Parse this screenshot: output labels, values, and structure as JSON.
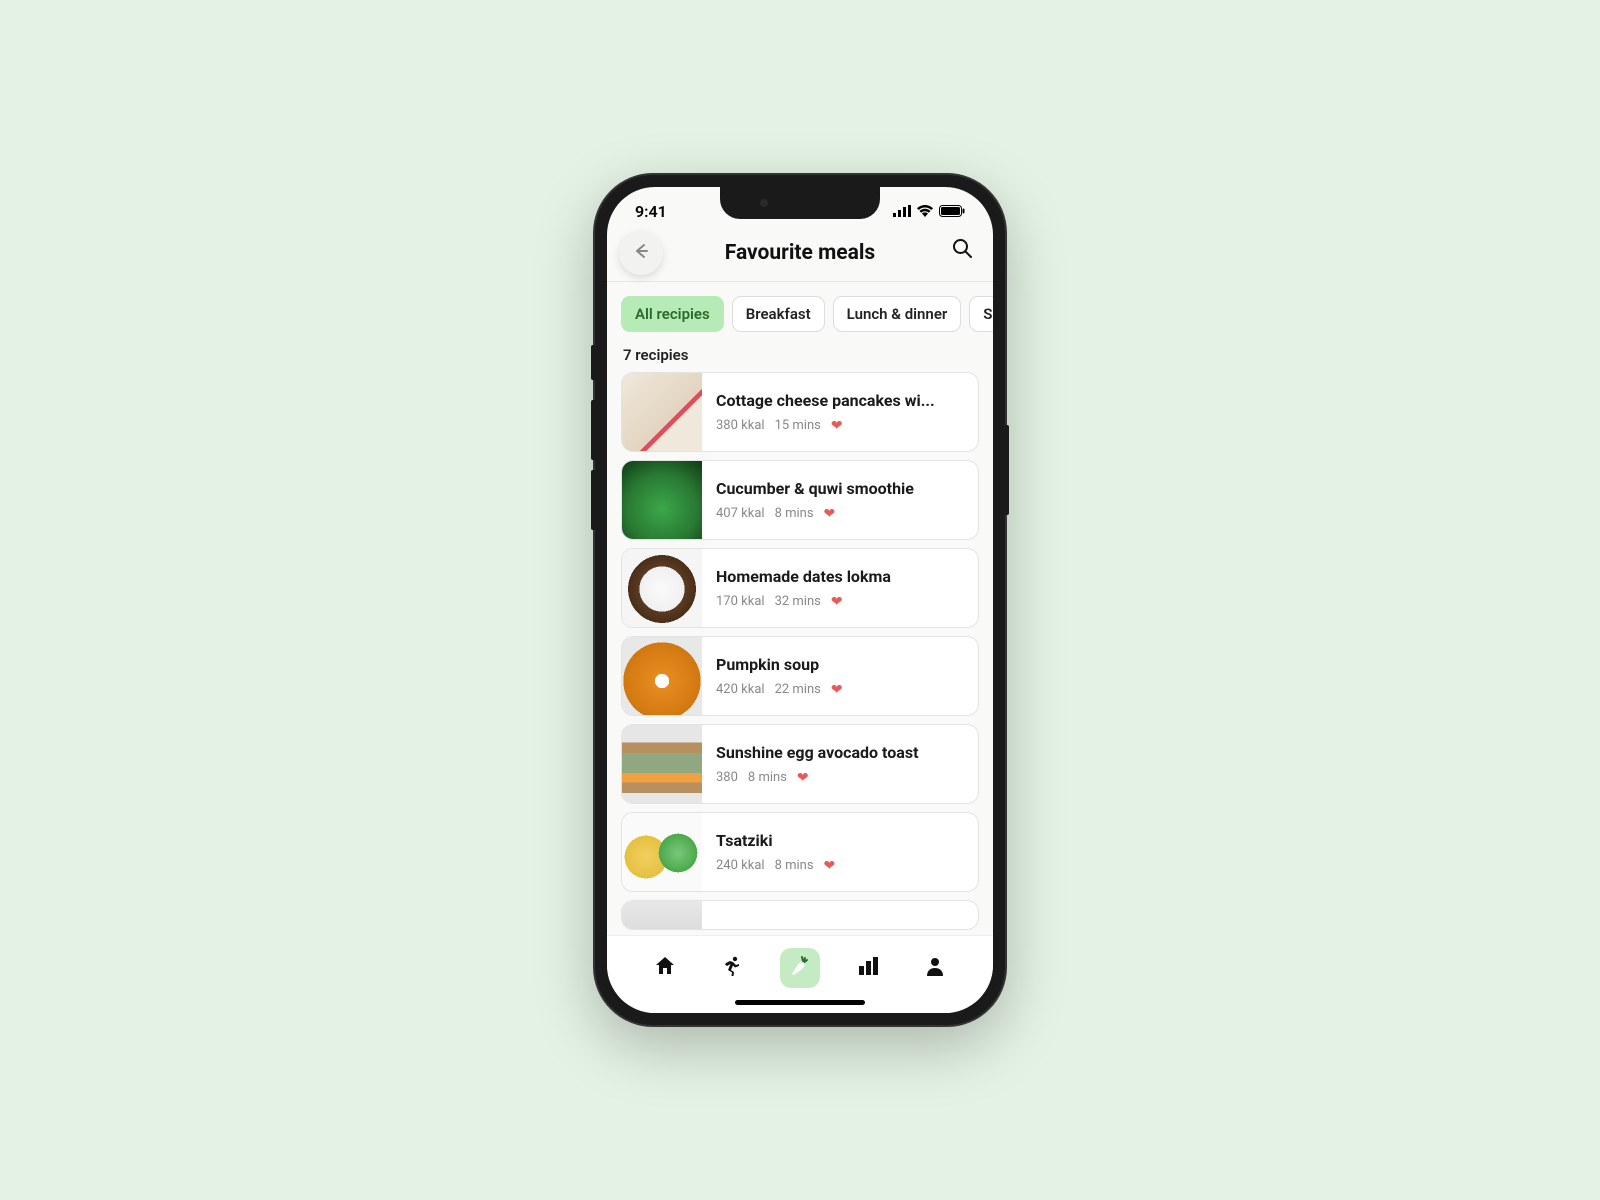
{
  "status": {
    "time": "9:41"
  },
  "header": {
    "title": "Favourite meals"
  },
  "filters": [
    {
      "label": "All recipies",
      "active": true
    },
    {
      "label": "Breakfast",
      "active": false
    },
    {
      "label": "Lunch & dinner",
      "active": false
    },
    {
      "label": "Snacks",
      "active": false
    }
  ],
  "count_label": "7 recipies",
  "recipes": [
    {
      "title": "Cottage cheese pancakes wi...",
      "kcal": "380 kkal",
      "time": "15 mins"
    },
    {
      "title": "Cucumber & quwi smoothie",
      "kcal": "407 kkal",
      "time": "8 mins"
    },
    {
      "title": "Homemade dates lokma",
      "kcal": "170 kkal",
      "time": "32 mins"
    },
    {
      "title": "Pumpkin soup",
      "kcal": "420 kkal",
      "time": "22 mins"
    },
    {
      "title": "Sunshine egg avocado toast",
      "kcal": "380",
      "time": "8 mins"
    },
    {
      "title": "Tsatziki",
      "kcal": "240 kkal",
      "time": "8 mins"
    }
  ]
}
